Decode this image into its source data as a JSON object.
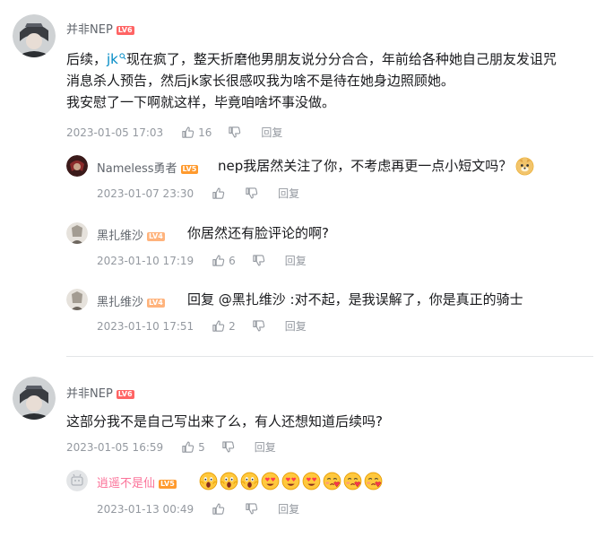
{
  "threads": [
    {
      "user": {
        "name": "并非NEP",
        "level": "LV6"
      },
      "content": {
        "line1_a": "后续，",
        "line1_link": "jk",
        "line1_b": "现在疯了，整天折磨他男朋友说分分合合，年前给各种她自己朋友发诅咒",
        "line2": "消息杀人预告，然后jk家长很感叹我为啥不是待在她身边照顾她。",
        "line3": "我安慰了一下啊就这样，毕竟咱啥坏事没做。"
      },
      "time": "2023-01-05 17:03",
      "likes": "16",
      "reply_label": "回复",
      "replies": [
        {
          "user": {
            "name": "Nameless勇者",
            "level": "LV5"
          },
          "content": "nep我居然关注了你，不考虑再更一点小短文吗？",
          "emoji": "doge",
          "time": "2023-01-07 23:30",
          "likes": "",
          "reply_label": "回复"
        },
        {
          "user": {
            "name": "黑扎维沙",
            "level": "LV4"
          },
          "content": "你居然还有脸评论的啊?",
          "time": "2023-01-10 17:19",
          "likes": "6",
          "reply_label": "回复"
        },
        {
          "user": {
            "name": "黑扎维沙",
            "level": "LV4"
          },
          "content": "回复 @黑扎维沙 :对不起，是我误解了，你是真正的骑士",
          "time": "2023-01-10 17:51",
          "likes": "2",
          "reply_label": "回复"
        }
      ]
    },
    {
      "user": {
        "name": "并非NEP",
        "level": "LV6"
      },
      "content": {
        "line1": "这部分我不是自己写出来了么，有人还想知道后续吗?"
      },
      "time": "2023-01-05 16:59",
      "likes": "5",
      "reply_label": "回复",
      "replies": [
        {
          "user": {
            "name": "逍遥不是仙",
            "level": "LV5"
          },
          "emojis": [
            "scream",
            "scream",
            "scream",
            "heart-eyes",
            "heart-eyes",
            "heart-eyes",
            "kiss",
            "kiss",
            "kiss"
          ],
          "time": "2023-01-13 00:49",
          "likes": "",
          "reply_label": "回复"
        }
      ]
    }
  ],
  "colors": {
    "link": "#008ac5",
    "meta": "#9499a0",
    "vip_name": "#fb7299",
    "lv6": "#ff6464",
    "lv5": "#ff9a2e",
    "lv4": "#ffb37c"
  }
}
